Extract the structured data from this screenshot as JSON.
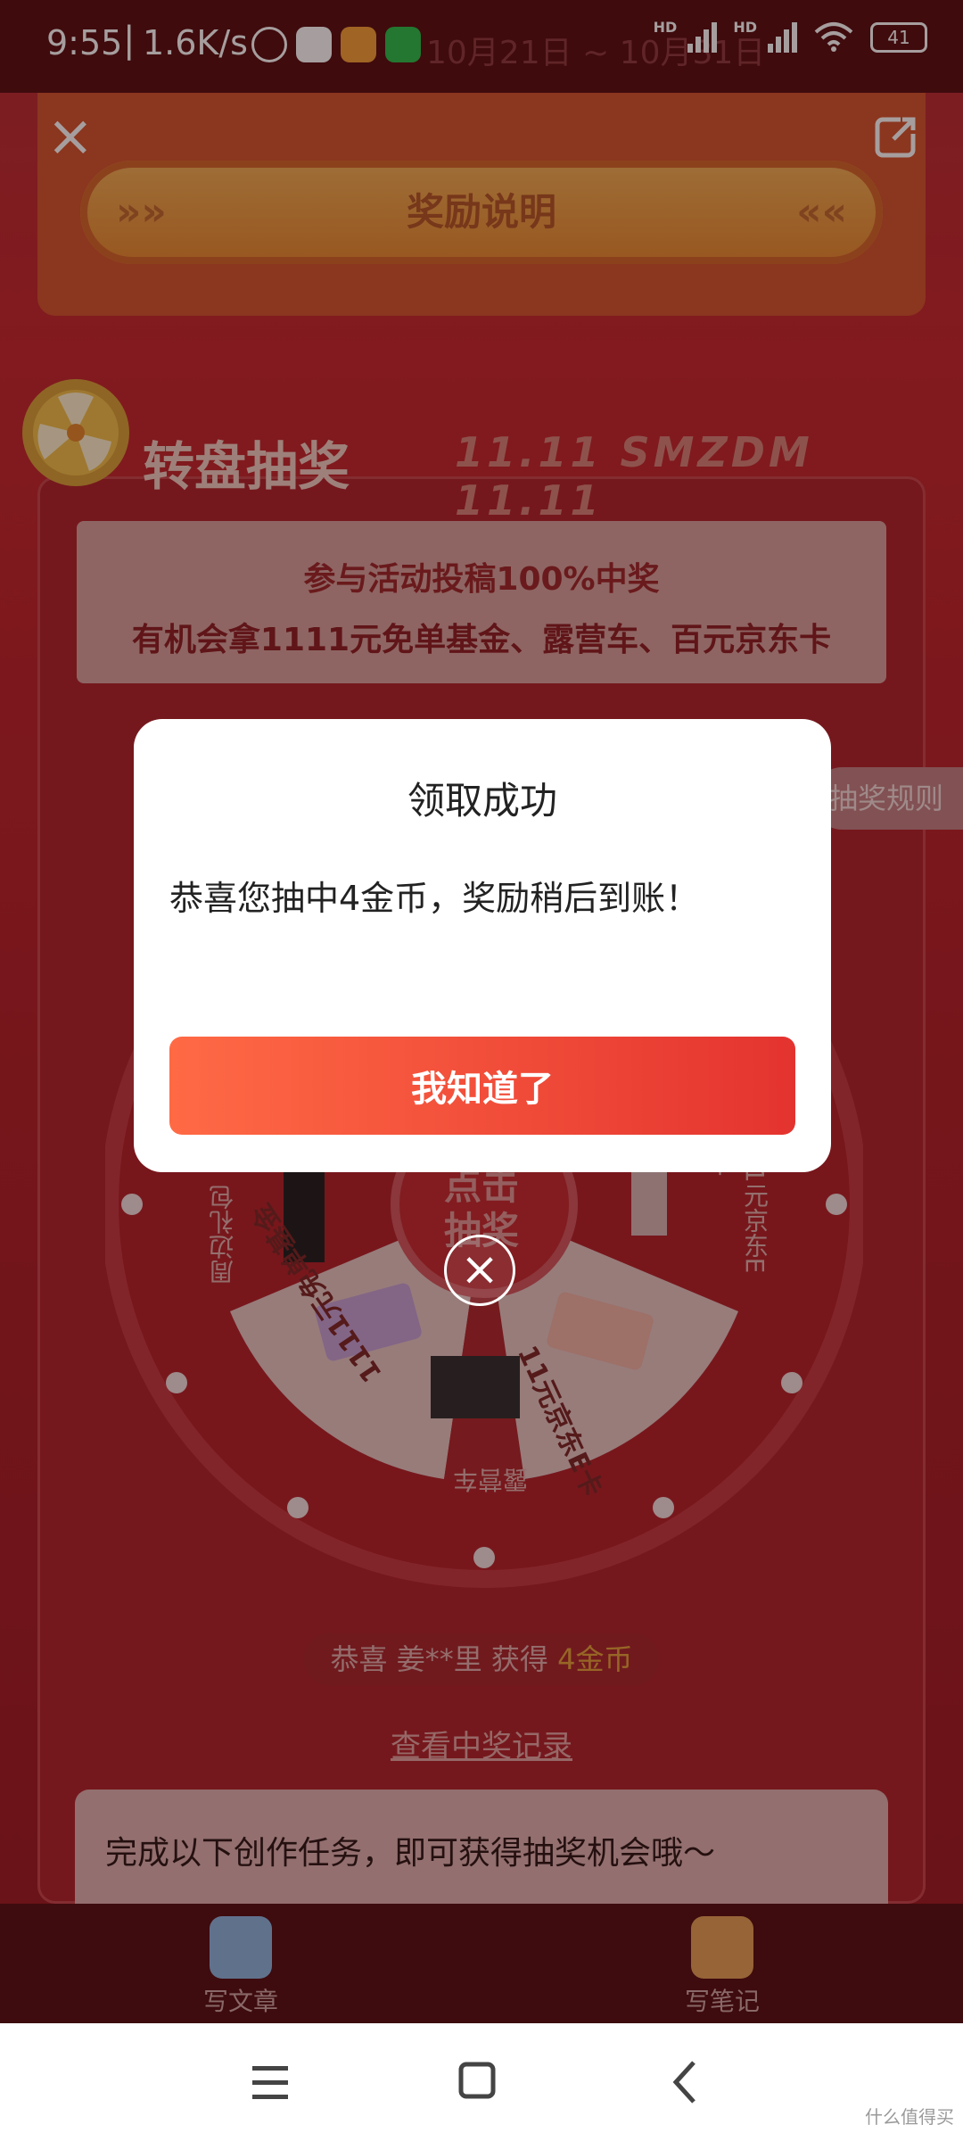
{
  "status_bar": {
    "time": "9:55",
    "net_speed": "1.6K/s",
    "battery": "41"
  },
  "header": {
    "bg_date_text": "10月21日 ~ 10月31日"
  },
  "rules_button": {
    "label": "奖励说明"
  },
  "lottery": {
    "title": "转盘抽奖",
    "banner_text": "11.11 SMZDM 11.11",
    "promo_line1": "参与活动投稿100%中奖",
    "promo_line2": "有机会拿1111元免单基金、露营车、百元京东卡",
    "rules_tab": "抽奖规则",
    "center_button": "点击抽奖",
    "prizes": [
      {
        "name": "周边礼包"
      },
      {
        "name": "11元京东E卡"
      },
      {
        "name": "11元京东E卡"
      },
      {
        "name": "露营车"
      },
      {
        "name": "1111元免单基金"
      }
    ],
    "broadcast_prefix": "恭喜 姜**里 获得",
    "broadcast_prize": "4金币",
    "records_link": "查看中奖记录",
    "tasks_text": "完成以下创作任务，即可获得抽奖机会哦～"
  },
  "action_bar": {
    "write_article": "写文章",
    "write_note": "写笔记"
  },
  "dialog": {
    "title": "领取成功",
    "message": "恭喜您抽中4金币，奖励稍后到账！",
    "confirm_label": "我知道了"
  },
  "watermark": "什么值得买",
  "colors": {
    "primary_button_start": "#ff6a45",
    "primary_button_end": "#e4332f",
    "bg_red": "#c52b32"
  }
}
